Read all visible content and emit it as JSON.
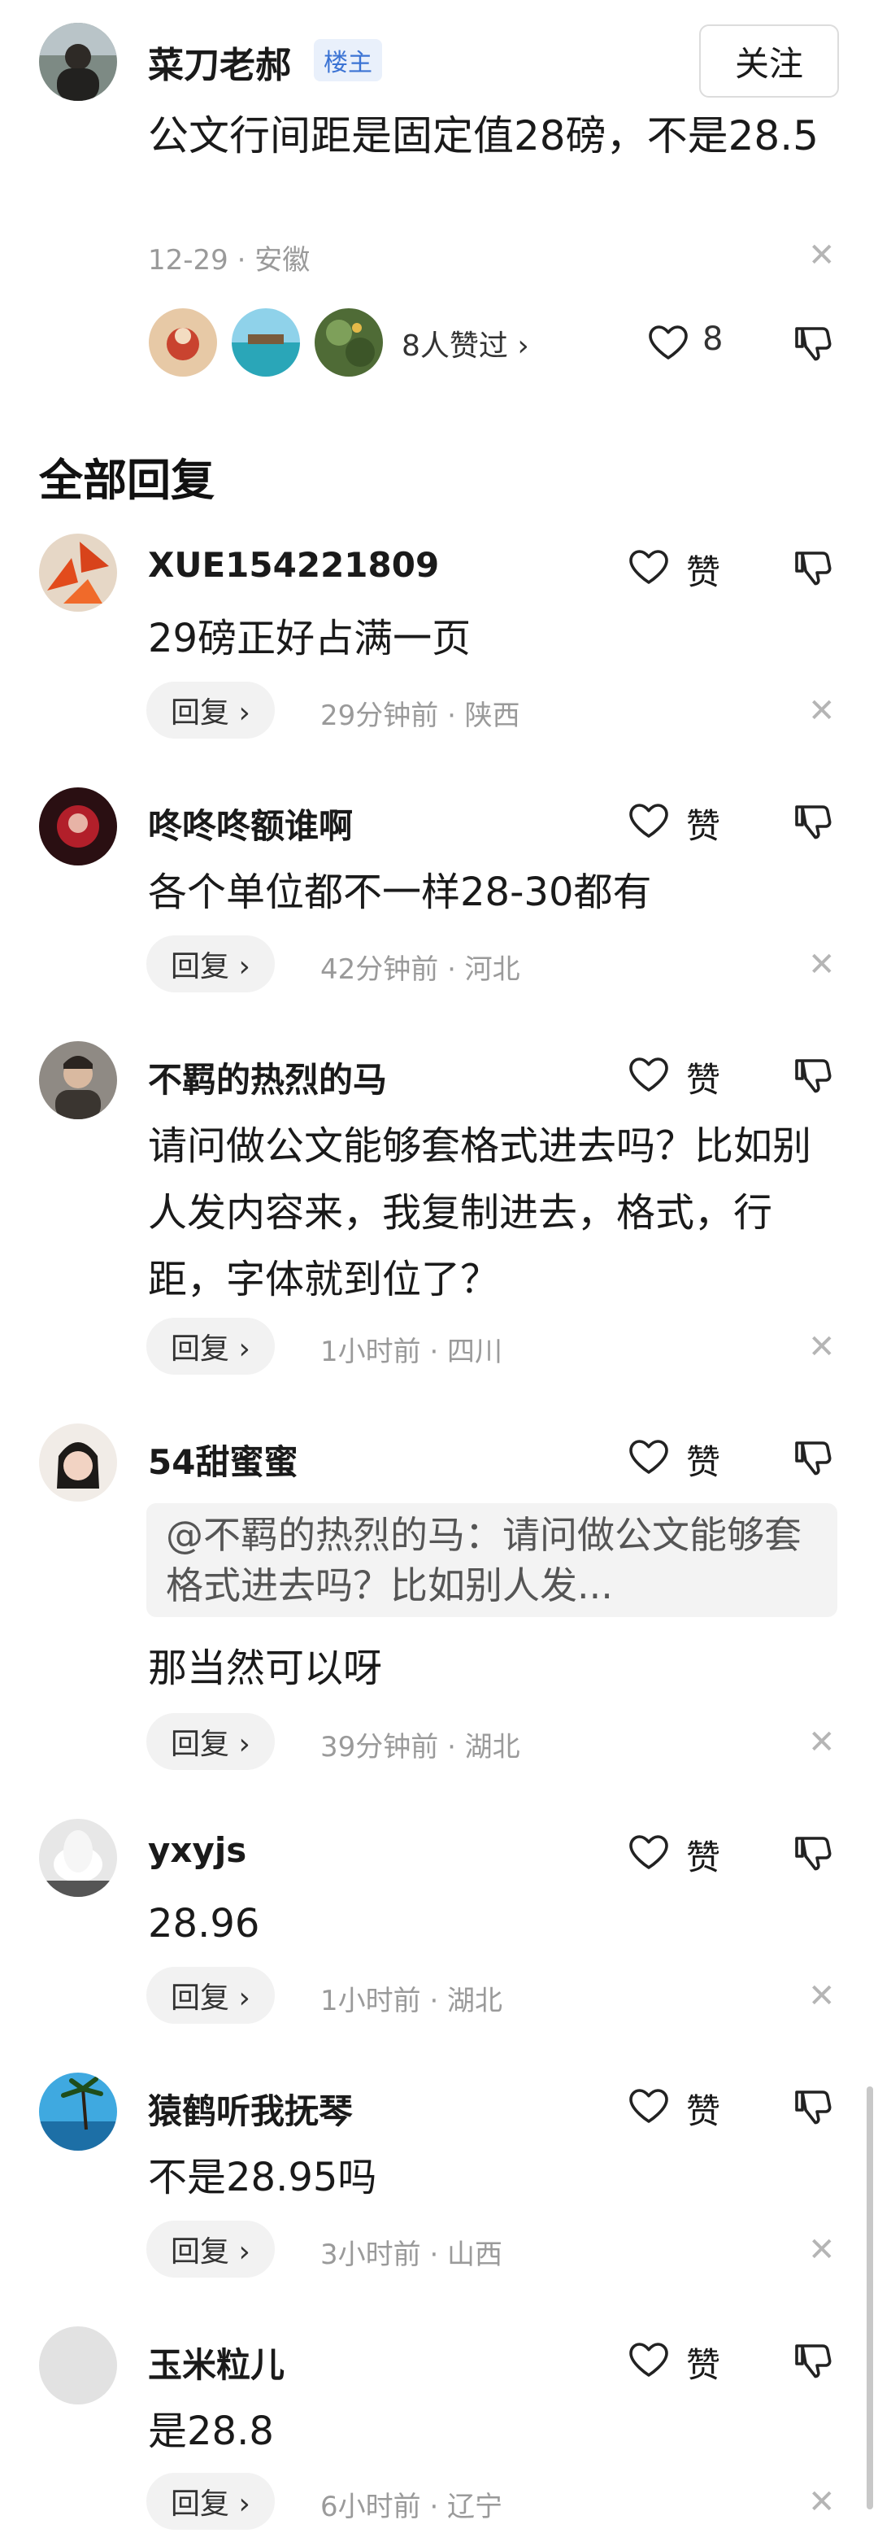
{
  "top_comment": {
    "username": "菜刀老郝",
    "badge": "楼主",
    "follow_label": "关注",
    "text": "公文行间距是固定值28磅，不是28.5",
    "meta": "12-29 · 安徽",
    "likers_text": "8人赞过 ›",
    "like_count": "8"
  },
  "section_title": "全部回复",
  "ui": {
    "reply_label": "回复 ›",
    "like_label": "赞"
  },
  "replies": [
    {
      "username": "XUE154221809",
      "text": "29磅正好占满一页",
      "meta": "29分钟前 · 陕西"
    },
    {
      "username": "咚咚咚额谁啊",
      "text": "各个单位都不一样28-30都有",
      "meta": "42分钟前 · 河北"
    },
    {
      "username": "不羁的热烈的马",
      "text": "请问做公文能够套格式进去吗？比如别人发内容来，我复制进去，格式，行距，字体就到位了？",
      "meta": "1小时前 · 四川"
    },
    {
      "username": "54甜蜜蜜",
      "quote": "@不羁的热烈的马：请问做公文能够套格式进去吗？比如别人发...",
      "text": "那当然可以呀",
      "meta": "39分钟前 · 湖北"
    },
    {
      "username": "yxyjs",
      "text": "28.96",
      "meta": "1小时前 · 湖北"
    },
    {
      "username": "猿鹤听我抚琴",
      "text": "不是28.95吗",
      "meta": "3小时前 · 山西"
    },
    {
      "username": "玉米粒儿",
      "text": "是28.8",
      "meta": "6小时前 · 辽宁"
    }
  ]
}
